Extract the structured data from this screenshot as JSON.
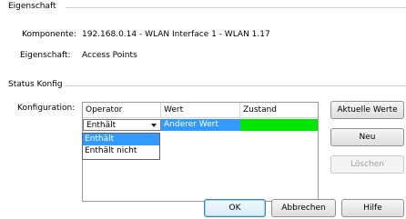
{
  "eigenschaft_group": {
    "title": "Eigenschaft",
    "komponente_label": "Komponente:",
    "komponente_value": "192.168.0.14 - WLAN Interface 1 - WLAN 1.17",
    "eigenschaft_label": "Eigenschaft:",
    "eigenschaft_value": "Access Points"
  },
  "status_group": {
    "title": "Status Konfig",
    "konfiguration_label": "Konfiguration:"
  },
  "table": {
    "columns": [
      "Operator",
      "Wert",
      "Zustand"
    ],
    "row": {
      "operator": "Enthält",
      "wert": "Anderer Wert",
      "zustand_color": "#00e600"
    }
  },
  "dropdown": {
    "options": [
      "Enthält",
      "Enthält nicht"
    ],
    "selected_index": 0
  },
  "buttons": {
    "aktuelle_werte": "Aktuelle Werte",
    "neu": "Neu",
    "loeschen": "Löschen",
    "ok": "OK",
    "abbrechen": "Abbrechen",
    "hilfe": "Hilfe"
  },
  "colors": {
    "selection": "#3399ff",
    "status_ok": "#00e600"
  }
}
